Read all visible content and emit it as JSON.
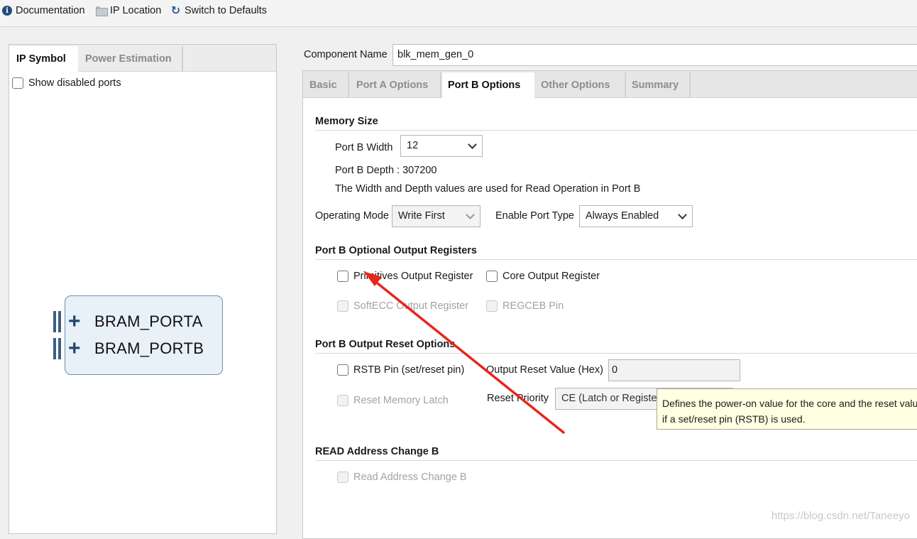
{
  "toolbar": {
    "documentation": "Documentation",
    "ip_location": "IP Location",
    "switch_defaults": "Switch to Defaults"
  },
  "left_panel": {
    "tabs": [
      {
        "label": "IP Symbol",
        "active": true
      },
      {
        "label": "Power Estimation",
        "active": false
      }
    ],
    "show_disabled_ports": {
      "label": "Show disabled ports",
      "checked": false
    },
    "ip_block": {
      "ports": [
        "BRAM_PORTA",
        "BRAM_PORTB"
      ]
    }
  },
  "component": {
    "label": "Component Name",
    "value": "blk_mem_gen_0"
  },
  "tabs": [
    {
      "label": "Basic",
      "active": false
    },
    {
      "label": "Port A Options",
      "active": false
    },
    {
      "label": "Port B Options",
      "active": true
    },
    {
      "label": "Other Options",
      "active": false
    },
    {
      "label": "Summary",
      "active": false
    }
  ],
  "memory_size": {
    "title": "Memory Size",
    "width_label": "Port B Width",
    "width_value": "12",
    "depth_text": "Port B Depth : 307200",
    "note": "The Width and Depth values are used for Read Operation in Port B",
    "operating_mode_label": "Operating Mode",
    "operating_mode_value": "Write First",
    "enable_port_label": "Enable Port Type",
    "enable_port_value": "Always Enabled"
  },
  "optional_output": {
    "title": "Port B Optional Output Registers",
    "primitives": "Primitives Output Register",
    "core": "Core Output Register",
    "softecc": "SoftECC Output Register",
    "regceb": "REGCEB Pin"
  },
  "reset": {
    "title": "Port B Output Reset Options",
    "rstb": "RSTB Pin (set/reset pin)",
    "reset_value_label": "Output Reset Value (Hex)",
    "reset_value": "0",
    "reset_latch": "Reset Memory Latch",
    "priority_label": "Reset Priority",
    "priority_value": "CE (Latch or Register)"
  },
  "tooltip": {
    "line1": "Defines the power-on value for the core and the reset value",
    "line2": "if a set/reset pin (RSTB) is used."
  },
  "read_address": {
    "title": "READ Address Change B",
    "checkbox": "Read Address Change B"
  },
  "watermark": "https://blog.csdn.net/Taneeyo",
  "colors": {
    "arrow": "#e8261c",
    "tooltip_bg": "#ffffe1",
    "block_fill": "#e8f0f8",
    "block_border": "#6f8fb0"
  }
}
